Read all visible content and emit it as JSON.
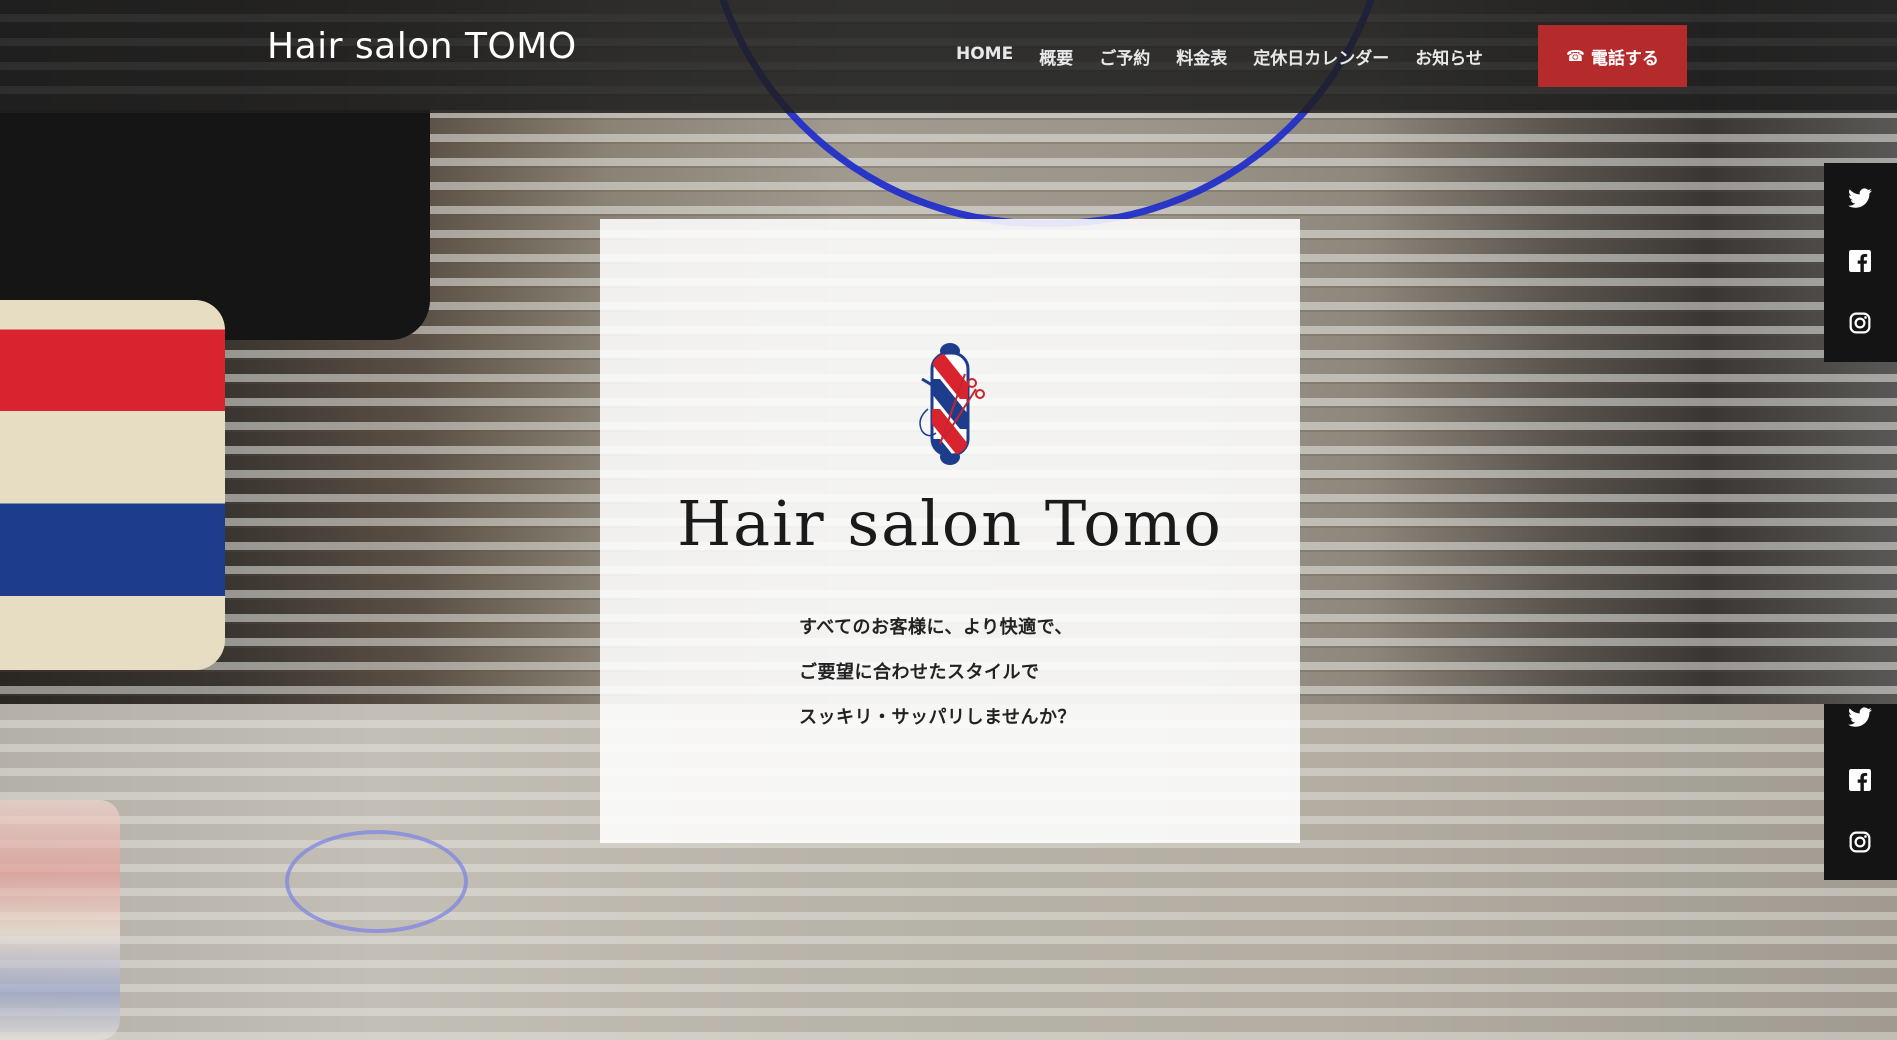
{
  "header": {
    "site_title": "Hair salon TOMO",
    "nav": [
      {
        "label": "HOME"
      },
      {
        "label": "概要"
      },
      {
        "label": "ご予約"
      },
      {
        "label": "料金表"
      },
      {
        "label": "定休日カレンダー"
      },
      {
        "label": "お知らせ"
      }
    ],
    "call_button": {
      "icon": "☎",
      "label": "電話する"
    }
  },
  "hero": {
    "logo_icon": "barber-pole-scissors-icon",
    "title": "Hair salon Tomo",
    "lines": [
      "すべてのお客様に、より快適で、",
      "ご要望に合わせたスタイルで",
      "スッキリ・サッパリしませんか？"
    ]
  },
  "social": {
    "icons": [
      "twitter-icon",
      "facebook-icon",
      "instagram-icon"
    ]
  },
  "colors": {
    "header_bg": "#1e1e1e",
    "call_button_bg": "#b52a2a",
    "pole_red": "#d9232e",
    "pole_blue": "#1d3d8c"
  }
}
